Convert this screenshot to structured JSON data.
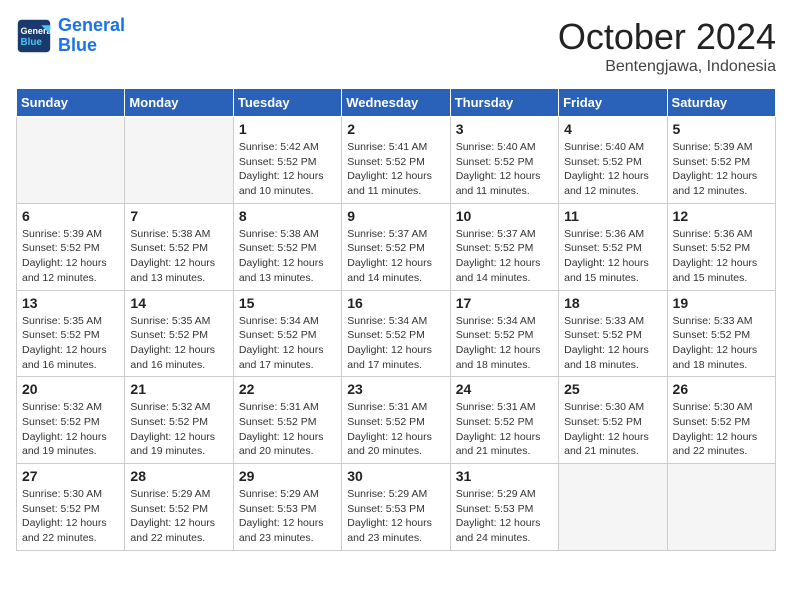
{
  "header": {
    "logo_line1": "General",
    "logo_line2": "Blue",
    "month": "October 2024",
    "location": "Bentengjawa, Indonesia"
  },
  "weekdays": [
    "Sunday",
    "Monday",
    "Tuesday",
    "Wednesday",
    "Thursday",
    "Friday",
    "Saturday"
  ],
  "weeks": [
    [
      {
        "day": "",
        "info": ""
      },
      {
        "day": "",
        "info": ""
      },
      {
        "day": "1",
        "info": "Sunrise: 5:42 AM\nSunset: 5:52 PM\nDaylight: 12 hours\nand 10 minutes."
      },
      {
        "day": "2",
        "info": "Sunrise: 5:41 AM\nSunset: 5:52 PM\nDaylight: 12 hours\nand 11 minutes."
      },
      {
        "day": "3",
        "info": "Sunrise: 5:40 AM\nSunset: 5:52 PM\nDaylight: 12 hours\nand 11 minutes."
      },
      {
        "day": "4",
        "info": "Sunrise: 5:40 AM\nSunset: 5:52 PM\nDaylight: 12 hours\nand 12 minutes."
      },
      {
        "day": "5",
        "info": "Sunrise: 5:39 AM\nSunset: 5:52 PM\nDaylight: 12 hours\nand 12 minutes."
      }
    ],
    [
      {
        "day": "6",
        "info": "Sunrise: 5:39 AM\nSunset: 5:52 PM\nDaylight: 12 hours\nand 12 minutes."
      },
      {
        "day": "7",
        "info": "Sunrise: 5:38 AM\nSunset: 5:52 PM\nDaylight: 12 hours\nand 13 minutes."
      },
      {
        "day": "8",
        "info": "Sunrise: 5:38 AM\nSunset: 5:52 PM\nDaylight: 12 hours\nand 13 minutes."
      },
      {
        "day": "9",
        "info": "Sunrise: 5:37 AM\nSunset: 5:52 PM\nDaylight: 12 hours\nand 14 minutes."
      },
      {
        "day": "10",
        "info": "Sunrise: 5:37 AM\nSunset: 5:52 PM\nDaylight: 12 hours\nand 14 minutes."
      },
      {
        "day": "11",
        "info": "Sunrise: 5:36 AM\nSunset: 5:52 PM\nDaylight: 12 hours\nand 15 minutes."
      },
      {
        "day": "12",
        "info": "Sunrise: 5:36 AM\nSunset: 5:52 PM\nDaylight: 12 hours\nand 15 minutes."
      }
    ],
    [
      {
        "day": "13",
        "info": "Sunrise: 5:35 AM\nSunset: 5:52 PM\nDaylight: 12 hours\nand 16 minutes."
      },
      {
        "day": "14",
        "info": "Sunrise: 5:35 AM\nSunset: 5:52 PM\nDaylight: 12 hours\nand 16 minutes."
      },
      {
        "day": "15",
        "info": "Sunrise: 5:34 AM\nSunset: 5:52 PM\nDaylight: 12 hours\nand 17 minutes."
      },
      {
        "day": "16",
        "info": "Sunrise: 5:34 AM\nSunset: 5:52 PM\nDaylight: 12 hours\nand 17 minutes."
      },
      {
        "day": "17",
        "info": "Sunrise: 5:34 AM\nSunset: 5:52 PM\nDaylight: 12 hours\nand 18 minutes."
      },
      {
        "day": "18",
        "info": "Sunrise: 5:33 AM\nSunset: 5:52 PM\nDaylight: 12 hours\nand 18 minutes."
      },
      {
        "day": "19",
        "info": "Sunrise: 5:33 AM\nSunset: 5:52 PM\nDaylight: 12 hours\nand 18 minutes."
      }
    ],
    [
      {
        "day": "20",
        "info": "Sunrise: 5:32 AM\nSunset: 5:52 PM\nDaylight: 12 hours\nand 19 minutes."
      },
      {
        "day": "21",
        "info": "Sunrise: 5:32 AM\nSunset: 5:52 PM\nDaylight: 12 hours\nand 19 minutes."
      },
      {
        "day": "22",
        "info": "Sunrise: 5:31 AM\nSunset: 5:52 PM\nDaylight: 12 hours\nand 20 minutes."
      },
      {
        "day": "23",
        "info": "Sunrise: 5:31 AM\nSunset: 5:52 PM\nDaylight: 12 hours\nand 20 minutes."
      },
      {
        "day": "24",
        "info": "Sunrise: 5:31 AM\nSunset: 5:52 PM\nDaylight: 12 hours\nand 21 minutes."
      },
      {
        "day": "25",
        "info": "Sunrise: 5:30 AM\nSunset: 5:52 PM\nDaylight: 12 hours\nand 21 minutes."
      },
      {
        "day": "26",
        "info": "Sunrise: 5:30 AM\nSunset: 5:52 PM\nDaylight: 12 hours\nand 22 minutes."
      }
    ],
    [
      {
        "day": "27",
        "info": "Sunrise: 5:30 AM\nSunset: 5:52 PM\nDaylight: 12 hours\nand 22 minutes."
      },
      {
        "day": "28",
        "info": "Sunrise: 5:29 AM\nSunset: 5:52 PM\nDaylight: 12 hours\nand 22 minutes."
      },
      {
        "day": "29",
        "info": "Sunrise: 5:29 AM\nSunset: 5:53 PM\nDaylight: 12 hours\nand 23 minutes."
      },
      {
        "day": "30",
        "info": "Sunrise: 5:29 AM\nSunset: 5:53 PM\nDaylight: 12 hours\nand 23 minutes."
      },
      {
        "day": "31",
        "info": "Sunrise: 5:29 AM\nSunset: 5:53 PM\nDaylight: 12 hours\nand 24 minutes."
      },
      {
        "day": "",
        "info": ""
      },
      {
        "day": "",
        "info": ""
      }
    ]
  ]
}
